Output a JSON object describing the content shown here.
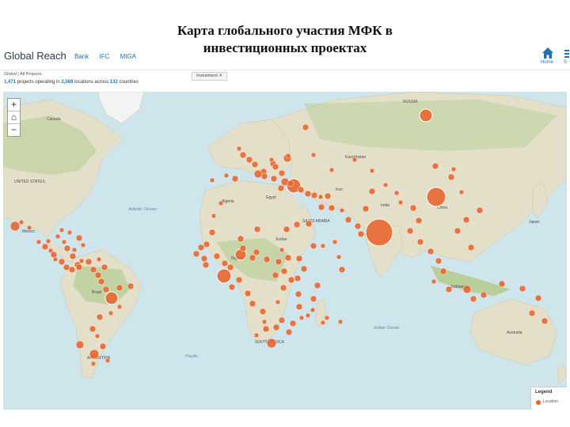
{
  "slide_title_line1": "Карта глобального участия МФК в",
  "slide_title_line2": "инвестиционных проектах",
  "header": {
    "logo": "Global Reach",
    "nav": [
      "Bank",
      "IFC",
      "MIGA"
    ],
    "home_label": "Home",
    "share_label": "S"
  },
  "info": {
    "breadcrumb": "Global  |  All Projects",
    "stats_num1": "1,471",
    "stats_text1": " projects operating in ",
    "stats_num2": "2,569",
    "stats_text2": " locations across ",
    "stats_num3": "132",
    "stats_text3": " countries",
    "filter": "Investment  ✕"
  },
  "zoom": {
    "in": "+",
    "home": "⌂",
    "out": "−"
  },
  "legend": {
    "title": "Legend",
    "item": "Location"
  },
  "colors": {
    "marker": "#e8642a",
    "land": "#e4dfc9",
    "water": "#cfe5ec",
    "forest": "#b9cf9a"
  },
  "labels": {
    "russia": "RUSSIA",
    "canada": "Canada",
    "united_states": "UNITED STATES",
    "mexico": "Mexico",
    "brazil": "Brazil",
    "argentina": "ARGENTINA",
    "china": "China",
    "india": "India",
    "japan": "Japan",
    "australia": "Australia",
    "kazakhstan": "Kazakhstan",
    "iran": "Iran",
    "saudi": "SAUDI ARABIA",
    "egypt": "Egypt",
    "algeria": "Algeria",
    "nigeria": "Nigeria",
    "sudan": "Sudan",
    "south_africa": "SOUTH AFRICA",
    "indonesia": "Indonesia",
    "atlantic": "Atlantic Ocean",
    "indian_ocean": "Indian Ocean",
    "pacific": "Pacific"
  }
}
